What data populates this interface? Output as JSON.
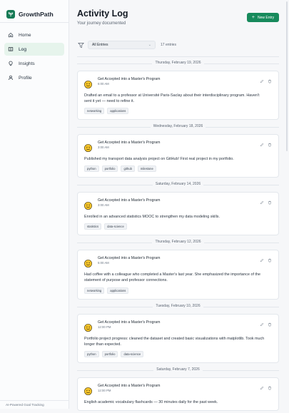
{
  "brand": {
    "name": "GrowthPath",
    "icon": "sprout-icon",
    "color": "#157a55"
  },
  "sidebar": {
    "items": [
      {
        "label": "Home",
        "icon": "home-icon",
        "active": false
      },
      {
        "label": "Log",
        "icon": "book-icon",
        "active": true
      },
      {
        "label": "Insights",
        "icon": "lightbulb-icon",
        "active": false
      },
      {
        "label": "Profile",
        "icon": "user-icon",
        "active": false
      }
    ],
    "footer": "AI-Powered Goal Tracking"
  },
  "header": {
    "title": "Activity Log",
    "subtitle": "Your journey documented",
    "new_entry_label": "New Entry",
    "accent": "#178a5c"
  },
  "filter": {
    "selected": "All Entries",
    "count": "17 entries"
  },
  "feed": [
    {
      "date": "Thursday, February 19, 2026",
      "goal": "Get Accepted into a Master's Program",
      "time": "6:00 AM",
      "text": "Drafted an email to a professor at Université Paris-Saclay about their interdisciplinary program. Haven't sent it yet — need to refine it.",
      "tags": [
        "networking",
        "applications"
      ]
    },
    {
      "date": "Wednesday, February 18, 2026",
      "goal": "Get Accepted into a Master's Program",
      "time": "3:00 AM",
      "text": "Published my transport data analysis project on GitHub! First real project in my portfolio.",
      "tags": [
        "python",
        "portfolio",
        "github",
        "milestone"
      ]
    },
    {
      "date": "Saturday, February 14, 2026",
      "goal": "Get Accepted into a Master's Program",
      "time": "3:00 AM",
      "text": "Enrolled in an advanced statistics MOOC to strengthen my data modeling skills.",
      "tags": [
        "statistics",
        "data-science"
      ]
    },
    {
      "date": "Thursday, February 12, 2026",
      "goal": "Get Accepted into a Master's Program",
      "time": "5:00 AM",
      "text": "Had coffee with a colleague who completed a Master's last year. She emphasized the importance of the statement of purpose and professor connections.",
      "tags": [
        "networking",
        "applications"
      ]
    },
    {
      "date": "Tuesday, February 10, 2026",
      "goal": "Get Accepted into a Master's Program",
      "time": "12:00 PM",
      "text": "Portfolio project progress: cleaned the dataset and created basic visualizations with matplotlib. Took much longer than expected.",
      "tags": [
        "python",
        "portfolio",
        "data-science"
      ]
    },
    {
      "date": "Saturday, February 7, 2026",
      "goal": "Get Accepted into a Master's Program",
      "time": "12:00 PM",
      "text": "English academic vocabulary flashcards — 30 minutes daily for the past week.",
      "tags": []
    }
  ]
}
